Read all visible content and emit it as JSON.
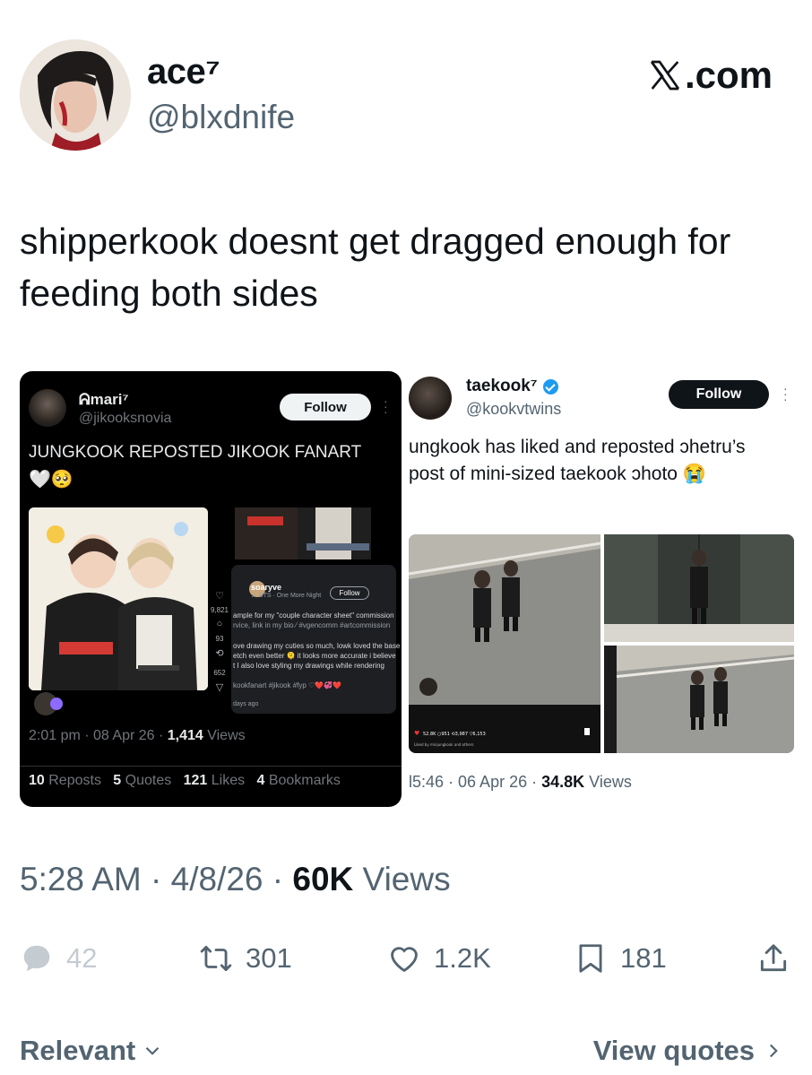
{
  "author": {
    "name": "ace⁷",
    "handle": "@blxdnife",
    "source": ".com"
  },
  "tweet": {
    "text": "shipperkook doesnt get dragged enough for feeding both sides"
  },
  "quote_left": {
    "name": "ᕱmari⁷",
    "handle": "@jikooksnovia",
    "follow_label": "Follow",
    "text": "JUNGKOOK REPOSTED JIKOOK FANART",
    "emojis": "🤍🥺",
    "inner": {
      "user": "soaryve",
      "sub": "♬ BTS · One More Night",
      "follow_label": "Follow",
      "line1": "ample for my \"couple character sheet\" commission",
      "line2": "rvice, link in my bio ⁄ #vgencomm #artcommission",
      "line3": "ove drawing my cuties so much, lowk loved the base",
      "line4": "etch even better 🫠 it looks more accurate i believe",
      "line5": "t I also love styling my drawings while rendering",
      "line6": "kookfanart #jikook #fyp ♡❤️💞❤️",
      "days": "days ago",
      "side_count1": "9,821",
      "side_count2": "93",
      "side_count3": "652"
    },
    "time": "2:01 pm · 08 Apr 26 · ",
    "views_count": "1,414",
    "views_label": " Views",
    "reposts_count": "10",
    "reposts_label": "Reposts",
    "quotes_count": "5",
    "quotes_label": "Quotes",
    "likes_count": "121",
    "likes_label": "Likes",
    "bookmarks_count": "4",
    "bookmarks_label": "Bookmarks"
  },
  "quote_right": {
    "name": "taekook⁷",
    "handle": "@kookvtwins",
    "follow_label": "Follow",
    "text": "ungkook has liked and reposted ɔhetru’s post of mini-sized taekook ɔhoto 😭",
    "time": "l5:46 · 06 Apr 26 · ",
    "views_count": "34.8K",
    "views_label": " Views"
  },
  "main_meta": {
    "time": "5:28 AM · 4/8/26 · ",
    "views_count": "60K",
    "views_label": " Views"
  },
  "actions": {
    "replies": "42",
    "reposts": "301",
    "likes": "1.2K",
    "bookmarks": "181"
  },
  "footer": {
    "relevant": "Relevant",
    "view_quotes": "View quotes"
  },
  "colors": {
    "text_primary": "#0f1419",
    "text_secondary": "#536471",
    "verified_blue": "#1d9bf0",
    "dark_card": "#000000"
  }
}
